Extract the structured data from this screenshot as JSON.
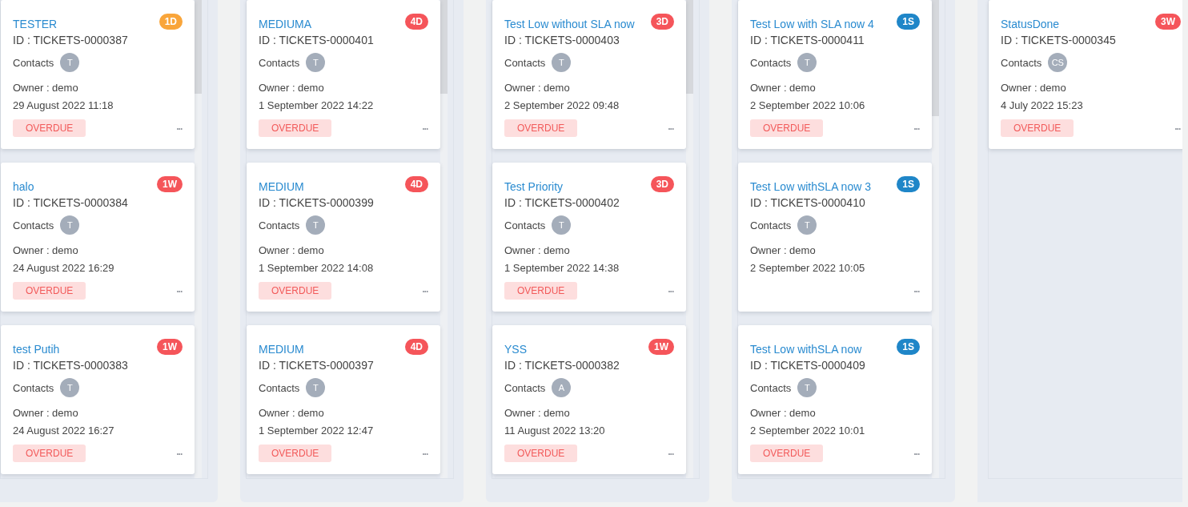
{
  "columns": [
    {
      "cards": [
        {
          "title": "TESTER",
          "badge": {
            "text": "1D",
            "color": "#f9a53a"
          },
          "id_line": "ID : TICKETS-0000387",
          "contacts_label": "Contacts",
          "contacts": [
            "T"
          ],
          "owner": "Owner : demo",
          "date": "29 August 2022 11:18",
          "tag": "OVERDUE",
          "menu": "•••"
        },
        {
          "title": "halo",
          "badge": {
            "text": "1W",
            "color": "#f5555a"
          },
          "id_line": "ID : TICKETS-0000384",
          "contacts_label": "Contacts",
          "contacts": [
            "T"
          ],
          "owner": "Owner : demo",
          "date": "24 August 2022 16:29",
          "tag": "OVERDUE",
          "menu": "•••"
        },
        {
          "title": "test Putih",
          "badge": {
            "text": "1W",
            "color": "#f5555a"
          },
          "id_line": "ID : TICKETS-0000383",
          "contacts_label": "Contacts",
          "contacts": [
            "T"
          ],
          "owner": "Owner : demo",
          "date": "24 August 2022 16:27",
          "tag": "OVERDUE",
          "menu": "•••"
        }
      ]
    },
    {
      "cards": [
        {
          "title": "MEDIUMA",
          "badge": {
            "text": "4D",
            "color": "#f5555a"
          },
          "id_line": "ID : TICKETS-0000401",
          "contacts_label": "Contacts",
          "contacts": [
            "T"
          ],
          "owner": "Owner : demo",
          "date": "1 September 2022 14:22",
          "tag": "OVERDUE",
          "menu": "•••"
        },
        {
          "title": "MEDIUM",
          "badge": {
            "text": "4D",
            "color": "#f5555a"
          },
          "id_line": "ID : TICKETS-0000399",
          "contacts_label": "Contacts",
          "contacts": [
            "T"
          ],
          "owner": "Owner : demo",
          "date": "1 September 2022 14:08",
          "tag": "OVERDUE",
          "menu": "•••"
        },
        {
          "title": "MEDIUM",
          "badge": {
            "text": "4D",
            "color": "#f5555a"
          },
          "id_line": "ID : TICKETS-0000397",
          "contacts_label": "Contacts",
          "contacts": [
            "T"
          ],
          "owner": "Owner : demo",
          "date": "1 September 2022 12:47",
          "tag": "OVERDUE",
          "menu": "•••"
        }
      ]
    },
    {
      "cards": [
        {
          "title": "Test Low without SLA now",
          "badge": {
            "text": "3D",
            "color": "#f5555a"
          },
          "id_line": "ID : TICKETS-0000403",
          "contacts_label": "Contacts",
          "contacts": [
            "T"
          ],
          "owner": "Owner : demo",
          "date": "2 September 2022 09:48",
          "tag": "OVERDUE",
          "menu": "•••"
        },
        {
          "title": "Test Priority",
          "badge": {
            "text": "3D",
            "color": "#f5555a"
          },
          "id_line": "ID : TICKETS-0000402",
          "contacts_label": "Contacts",
          "contacts": [
            "T"
          ],
          "owner": "Owner : demo",
          "date": "1 September 2022 14:38",
          "tag": "OVERDUE",
          "menu": "•••"
        },
        {
          "title": "YSS",
          "badge": {
            "text": "1W",
            "color": "#f5555a"
          },
          "id_line": "ID : TICKETS-0000382",
          "contacts_label": "Contacts",
          "contacts": [
            "A"
          ],
          "owner": "Owner : demo",
          "date": "11 August 2022 13:20",
          "tag": "OVERDUE",
          "menu": "•••"
        }
      ]
    },
    {
      "cards": [
        {
          "title": "Test Low with SLA now 4",
          "badge": {
            "text": "1S",
            "color": "#1f86c8"
          },
          "id_line": "ID : TICKETS-0000411",
          "contacts_label": "Contacts",
          "contacts": [
            "T"
          ],
          "owner": "Owner : demo",
          "date": "2 September 2022 10:06",
          "tag": "OVERDUE",
          "menu": "•••"
        },
        {
          "title": "Test Low withSLA now 3",
          "badge": {
            "text": "1S",
            "color": "#1f86c8"
          },
          "id_line": "ID : TICKETS-0000410",
          "contacts_label": "Contacts",
          "contacts": [
            "T"
          ],
          "owner": "Owner : demo",
          "date": "2 September 2022 10:05",
          "menu": "•••"
        },
        {
          "title": "Test Low withSLA now",
          "badge": {
            "text": "1S",
            "color": "#1f86c8"
          },
          "id_line": "ID : TICKETS-0000409",
          "contacts_label": "Contacts",
          "contacts": [
            "T"
          ],
          "owner": "Owner : demo",
          "date": "2 September 2022 10:01",
          "tag": "OVERDUE",
          "menu": "•••"
        }
      ]
    },
    {
      "cards": [
        {
          "title": "StatusDone",
          "badge": {
            "text": "3W",
            "color": "#f5555a"
          },
          "id_line": "ID : TICKETS-0000345",
          "contacts_label": "Contacts",
          "contacts": [
            "CS"
          ],
          "owner": "Owner : demo",
          "date": "4 July 2022 15:23",
          "tag": "OVERDUE",
          "menu": "•••"
        }
      ]
    }
  ]
}
